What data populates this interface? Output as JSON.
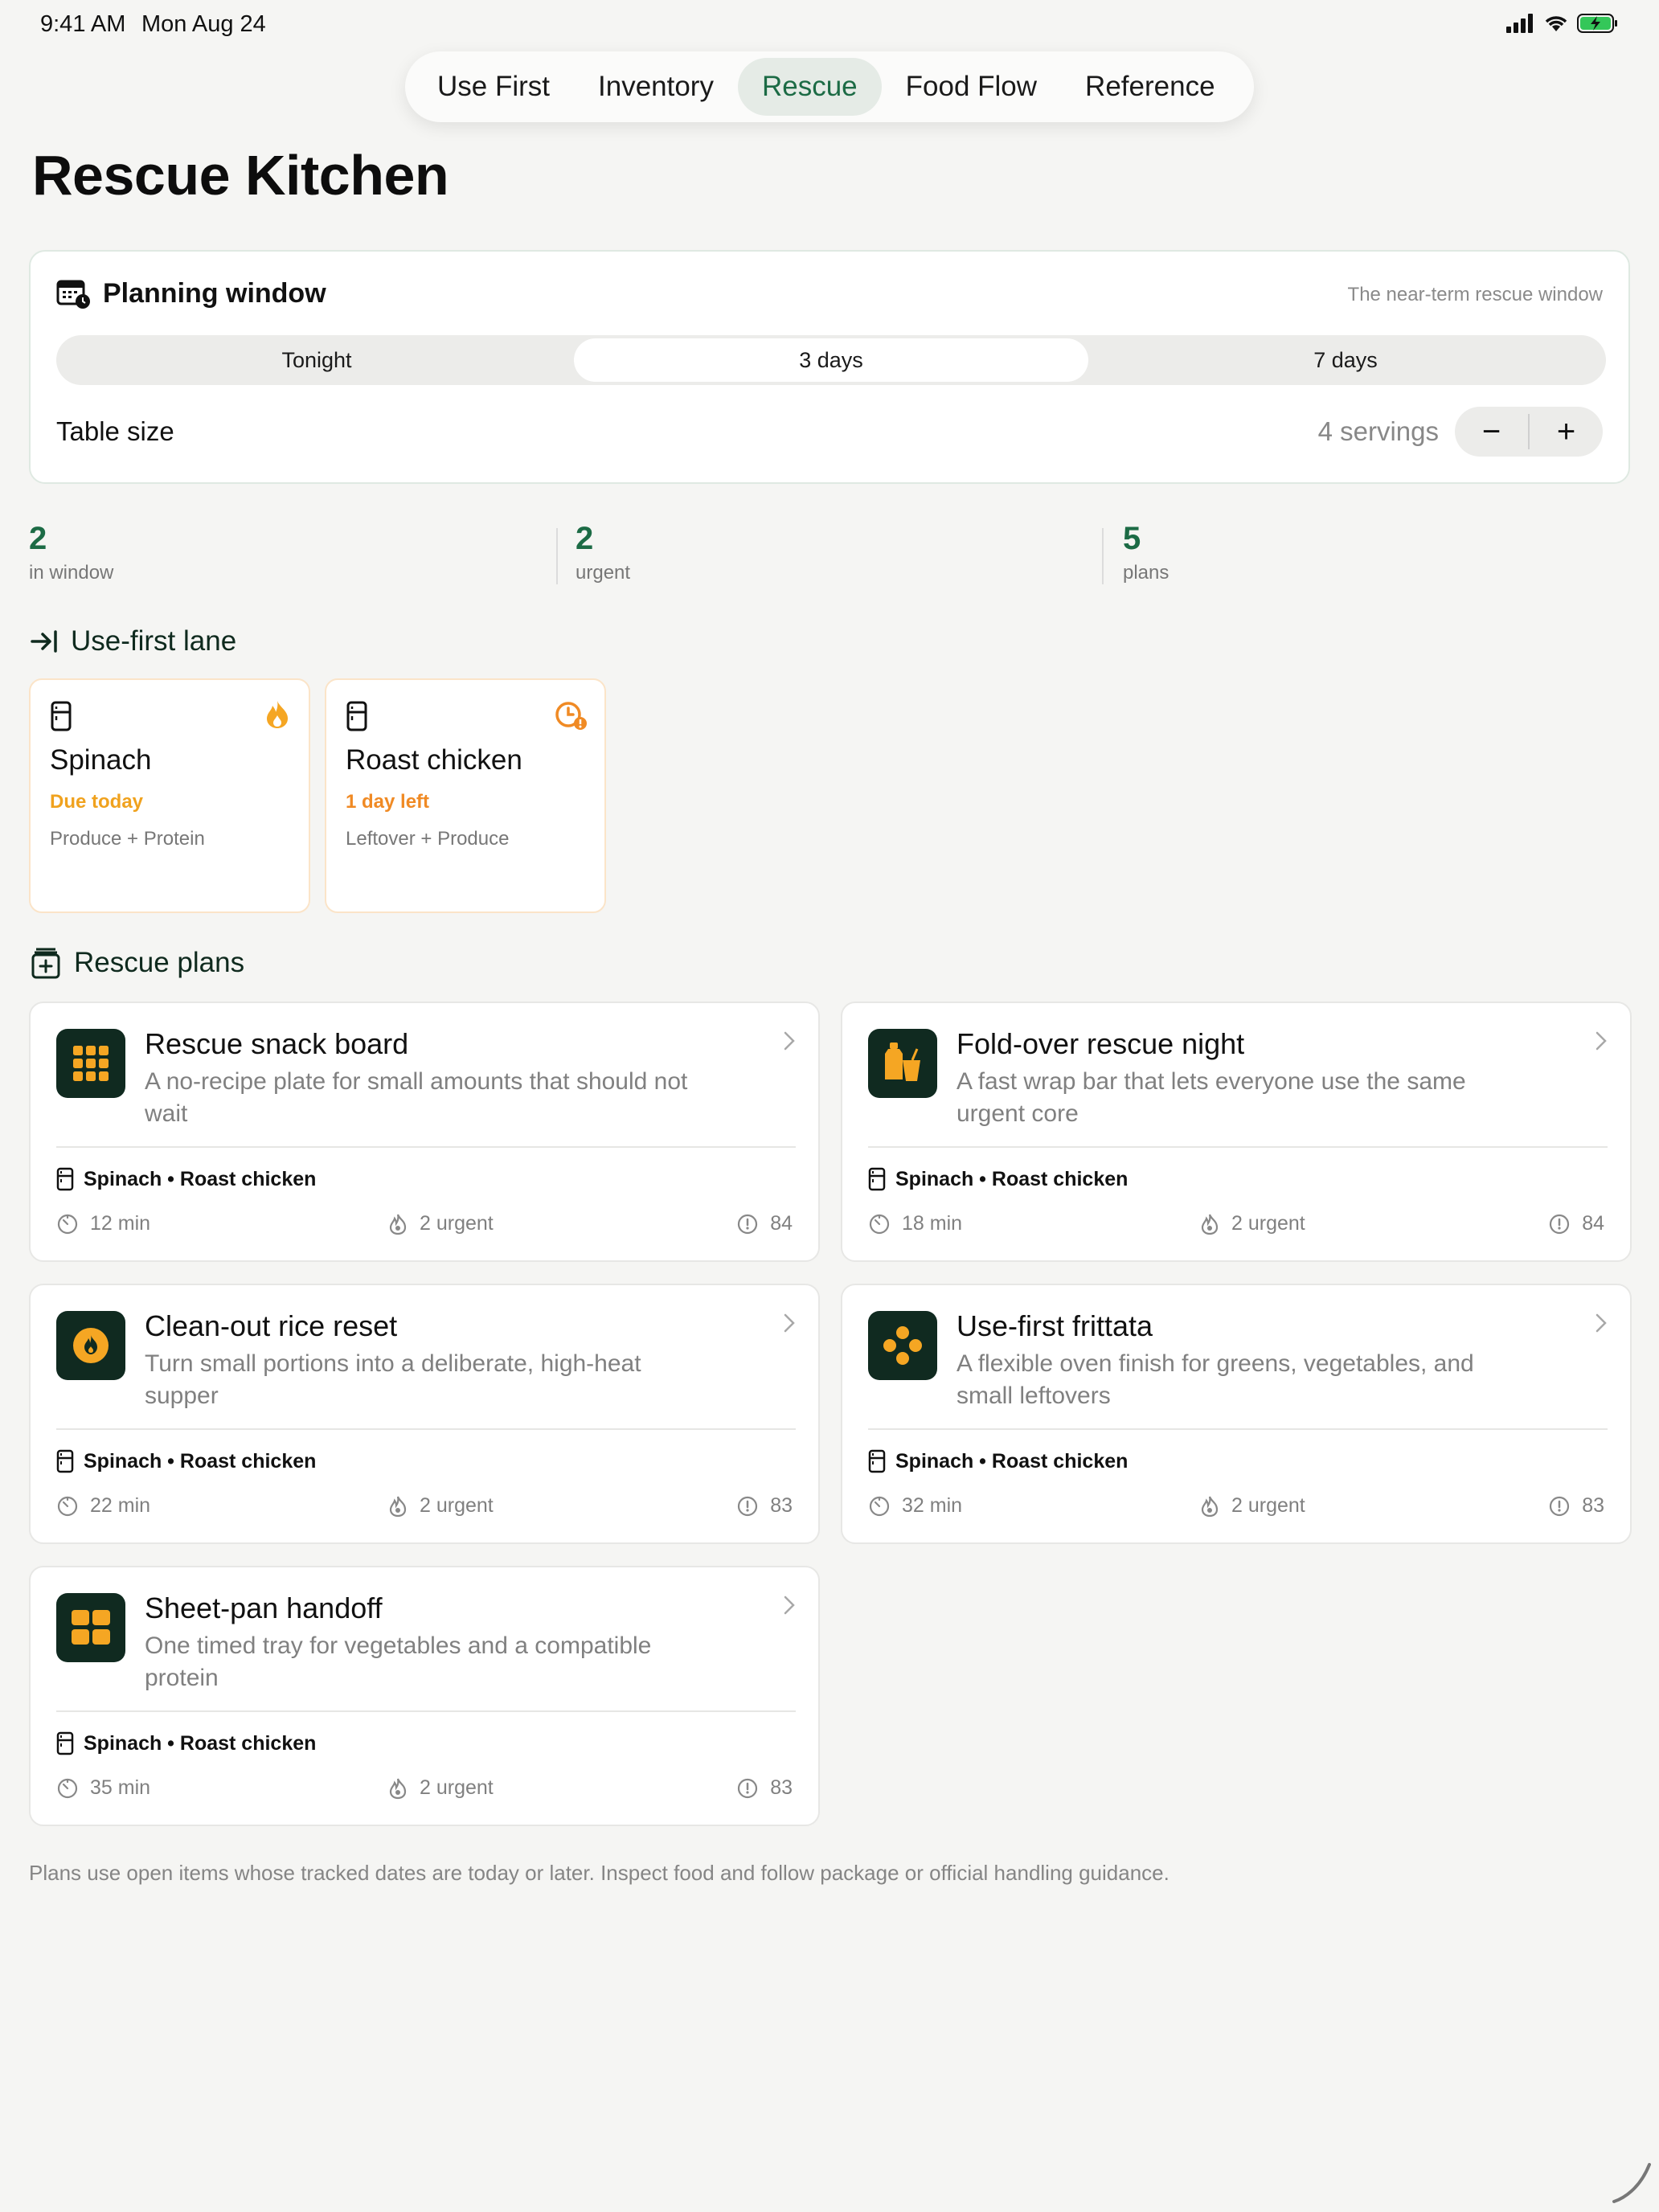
{
  "status": {
    "time": "9:41 AM",
    "date": "Mon Aug 24"
  },
  "tabs": [
    "Use First",
    "Inventory",
    "Rescue",
    "Food Flow",
    "Reference"
  ],
  "active_tab": "Rescue",
  "page_title": "Rescue Kitchen",
  "planning": {
    "title": "Planning window",
    "subtitle": "The near-term rescue window",
    "options": [
      "Tonight",
      "3 days",
      "7 days"
    ],
    "selected": "3 days",
    "table_label": "Table size",
    "servings": "4 servings",
    "minus": "−",
    "plus": "+"
  },
  "stats": [
    {
      "value": "2",
      "label": "in window"
    },
    {
      "value": "2",
      "label": "urgent"
    },
    {
      "value": "5",
      "label": "plans"
    }
  ],
  "lane": {
    "title": "Use-first lane",
    "items": [
      {
        "name": "Spinach",
        "due": "Due today",
        "due_color": "#f0a21e",
        "category": "Produce + Protein",
        "badge_icon": "flame-icon"
      },
      {
        "name": "Roast chicken",
        "due": "1 day left",
        "due_color": "#f08a24",
        "category": "Leftover + Produce",
        "badge_icon": "clock-alert-icon"
      }
    ]
  },
  "plans": {
    "title": "Rescue plans",
    "cards": [
      {
        "title": "Rescue snack board",
        "desc": "A no-recipe plate for small amounts that should not wait",
        "items": "Spinach • Roast chicken",
        "time": "12 min",
        "urgent": "2 urgent",
        "score": "84",
        "icon": "grid-icon"
      },
      {
        "title": "Fold-over rescue night",
        "desc": "A fast wrap bar that lets everyone use the same urgent core",
        "items": "Spinach • Roast chicken",
        "time": "18 min",
        "urgent": "2 urgent",
        "score": "84",
        "icon": "takeout-icon"
      },
      {
        "title": "Clean-out rice reset",
        "desc": "Turn small portions into a deliberate, high-heat supper",
        "items": "Spinach • Roast chicken",
        "time": "22 min",
        "urgent": "2 urgent",
        "score": "83",
        "icon": "flame-circle-icon"
      },
      {
        "title": "Use-first frittata",
        "desc": "A flexible oven finish for greens, vegetables, and small leftovers",
        "items": "Spinach • Roast chicken",
        "time": "32 min",
        "urgent": "2 urgent",
        "score": "83",
        "icon": "dots-icon"
      },
      {
        "title": "Sheet-pan handoff",
        "desc": "One timed tray for vegetables and a compatible protein",
        "items": "Spinach • Roast chicken",
        "time": "35 min",
        "urgent": "2 urgent",
        "score": "83",
        "icon": "tray-grid-icon"
      }
    ]
  },
  "footnote": "Plans use open items whose tracked dates are today or later. Inspect food and follow package or official handling guidance.",
  "colors": {
    "accent": "#1c6b45",
    "orange": "#f5a623",
    "icon_bg": "#102a20"
  }
}
